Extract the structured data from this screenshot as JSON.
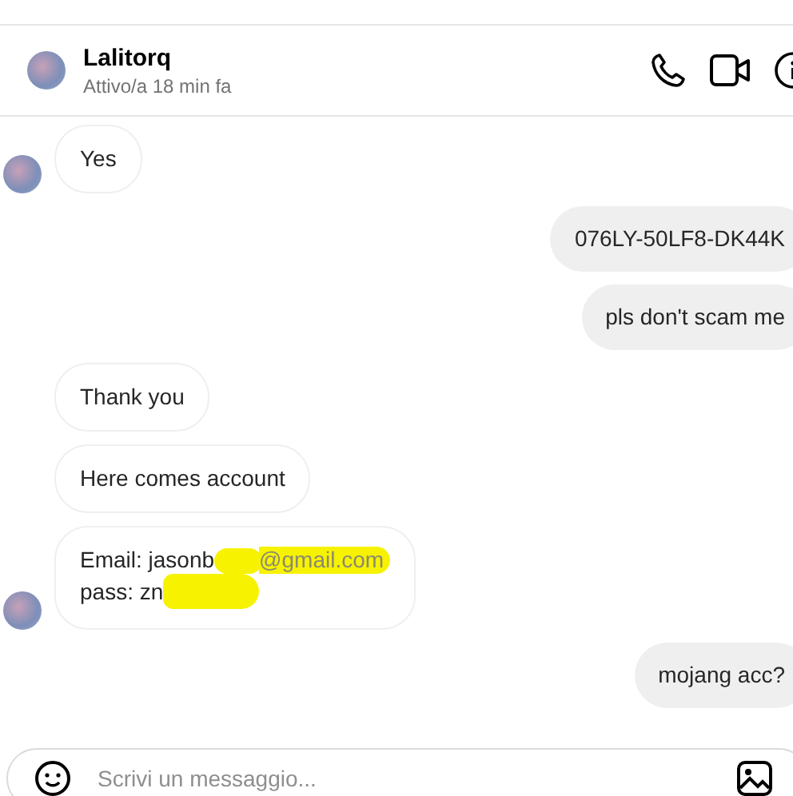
{
  "contact": {
    "name": "Lalitorq",
    "status": "Attivo/a 18 min fa"
  },
  "messages": [
    {
      "kind": "incoming",
      "show_avatar": true,
      "lines": [
        [
          {
            "kind": "text",
            "text": "Yes"
          }
        ]
      ]
    },
    {
      "kind": "outgoing",
      "lines": [
        [
          {
            "kind": "text",
            "text": "076LY-50LF8-DK44K"
          }
        ]
      ]
    },
    {
      "kind": "outgoing",
      "lines": [
        [
          {
            "kind": "text",
            "text": "pls don't scam me"
          }
        ]
      ]
    },
    {
      "kind": "incoming",
      "show_avatar": false,
      "lines": [
        [
          {
            "kind": "text",
            "text": "Thank you"
          }
        ]
      ]
    },
    {
      "kind": "incoming",
      "show_avatar": false,
      "lines": [
        [
          {
            "kind": "text",
            "text": "Here comes account"
          }
        ]
      ]
    },
    {
      "kind": "incoming",
      "show_avatar": true,
      "lines": [
        [
          {
            "kind": "text",
            "text": "Email: jasonb"
          },
          {
            "kind": "scribble"
          },
          {
            "kind": "scribbled_text",
            "text": "@gmail.com"
          }
        ],
        [
          {
            "kind": "text",
            "text": "pass: zn"
          },
          {
            "kind": "scribble"
          }
        ]
      ]
    },
    {
      "kind": "outgoing",
      "lines": [
        [
          {
            "kind": "text",
            "text": "mojang acc?"
          }
        ]
      ]
    }
  ],
  "composer": {
    "placeholder": "Scrivi un messaggio..."
  }
}
